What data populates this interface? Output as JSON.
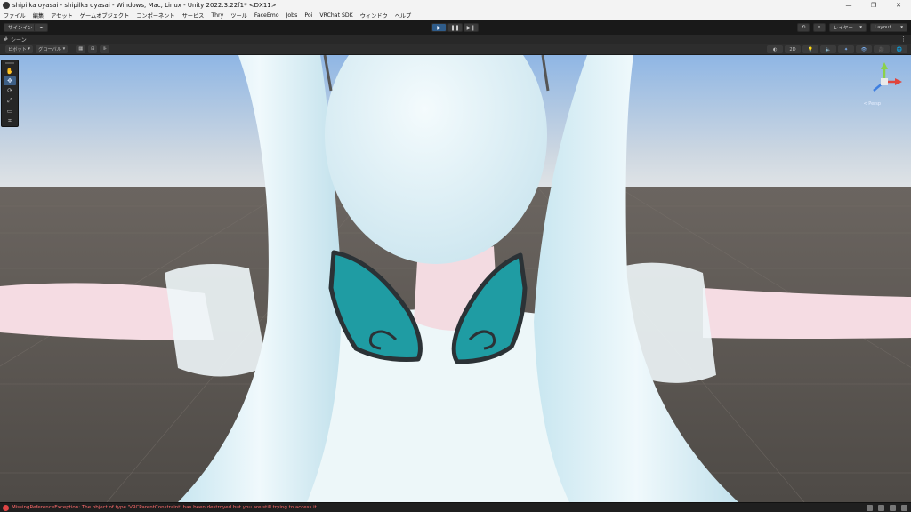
{
  "window": {
    "title": "shipilka oyasai - shipilka oyasai - Windows, Mac, Linux - Unity 2022.3.22f1* <DX11>",
    "minimize_glyph": "—",
    "maximize_glyph": "❐",
    "close_glyph": "✕"
  },
  "menu": [
    "ファイル",
    "編集",
    "アセット",
    "ゲームオブジェクト",
    "コンポーネント",
    "サービス",
    "Thry",
    "ツール",
    "FaceEmo",
    "Jobs",
    "Poi",
    "VRChat SDK",
    "ウィンドウ",
    "ヘルプ"
  ],
  "toolbar": {
    "signin_label": "サインイン",
    "cloud_glyph": "☁",
    "play_glyph": "▶",
    "pause_glyph": "❚❚",
    "step_glyph": "▶❙",
    "history_glyph": "⟲",
    "search_glyph": "⌕",
    "layers_label": "レイヤー",
    "layout_label": "Layout"
  },
  "scene_tab": {
    "hash_glyph": "#",
    "label": "シーン",
    "kebab_glyph": "⋮"
  },
  "scene_toolbar": {
    "pivot_label": "ピボット",
    "global_label": "グローバル",
    "grid_label": "▦",
    "snap_label": "⊞",
    "increment_label": "⊪",
    "shading_label": "◐",
    "mode_2d": "2D",
    "light_label": "💡",
    "audio_label": "🔈",
    "fx_label": "✦",
    "hidden_label": "👁",
    "camera_label": "🎥",
    "gizmos_label": "🌐"
  },
  "tools": [
    {
      "name": "hand-tool-icon",
      "glyph": "✋",
      "active": false
    },
    {
      "name": "move-tool-icon",
      "glyph": "✥",
      "active": true
    },
    {
      "name": "rotate-tool-icon",
      "glyph": "⟳",
      "active": false
    },
    {
      "name": "scale-tool-icon",
      "glyph": "⤢",
      "active": false
    },
    {
      "name": "rect-tool-icon",
      "glyph": "▭",
      "active": false
    },
    {
      "name": "transform-tool-icon",
      "glyph": "⌗",
      "active": false
    }
  ],
  "gizmo": {
    "persp_label": "< Persp",
    "x_color": "#e0453d",
    "y_color": "#8bd14a",
    "z_color": "#3f7fe0"
  },
  "console": {
    "message": "MissingReferenceException: The object of type 'VRCParentConstraint' has been destroyed but you are still trying to access it."
  },
  "colors": {
    "sky_top": "#90b8e6",
    "sky_horizon": "#d7dde3",
    "ground": "#5a5550",
    "hair": "#e4f3f8",
    "wing": "#1f9ca3",
    "wing_outline": "#2b3236",
    "skin": "#f6dde2",
    "accent": "#2f5c8a"
  }
}
